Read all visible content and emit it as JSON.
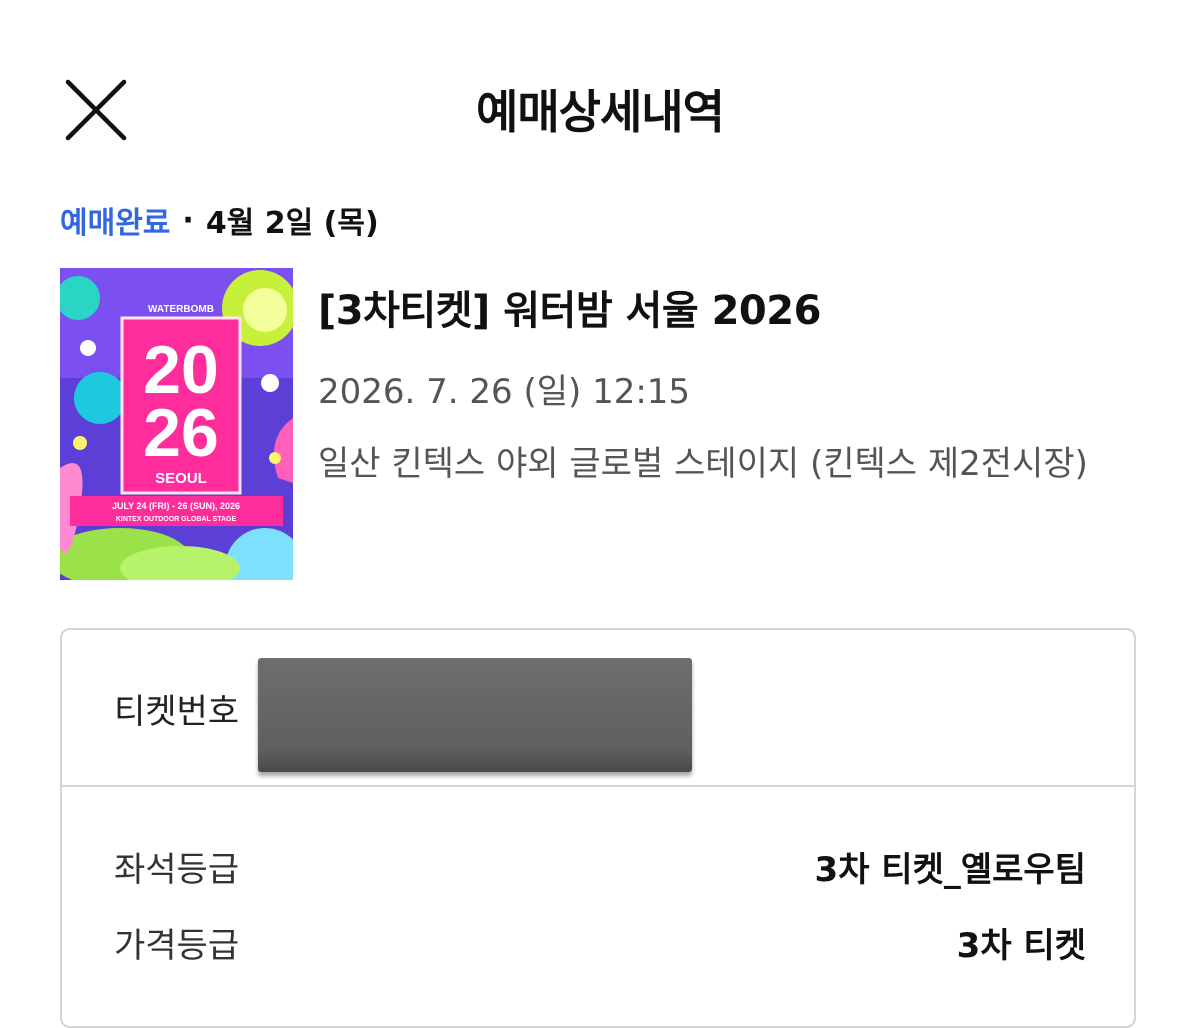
{
  "header": {
    "title": "예매상세내역",
    "close_icon": "close-icon"
  },
  "booking": {
    "status": "예매완료",
    "separator": "·",
    "booking_date": "4월 2일 (목)"
  },
  "event": {
    "title": "[3차티켓] 워터밤 서울 2026",
    "datetime": "2026. 7. 26 (일) 12:15",
    "venue": "일산 킨텍스 야외 글로벌 스테이지 (킨텍스 제2전시장)",
    "poster": {
      "brand": "WATERBOMB",
      "year_top": "20",
      "year_bottom": "26",
      "city": "SEOUL",
      "dates": "JULY 24 (FRI) - 26 (SUN), 2026",
      "stage": "KINTEX OUTDOOR GLOBAL STAGE",
      "accent_color": "#ff2d9b"
    }
  },
  "details": {
    "ticket_number_label": "티켓번호",
    "rows": [
      {
        "label": "좌석등급",
        "value": "3차 티켓_옐로우팀"
      },
      {
        "label": "가격등급",
        "value": "3차 티켓"
      }
    ]
  },
  "colors": {
    "status_blue": "#3366e0",
    "border_gray": "#d4d4d4",
    "secondary_text": "#555555"
  }
}
